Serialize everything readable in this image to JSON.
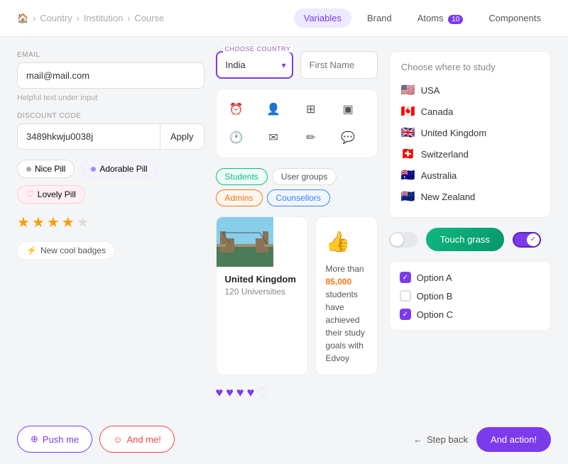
{
  "topbar": {
    "breadcrumb": [
      "Home",
      "Country",
      "Institution",
      "Course"
    ],
    "nav_tabs": [
      {
        "label": "Variables",
        "active": true,
        "badge": null
      },
      {
        "label": "Brand",
        "active": false,
        "badge": null
      },
      {
        "label": "Atoms",
        "active": false,
        "badge": "10"
      },
      {
        "label": "Components",
        "active": false,
        "badge": null
      }
    ]
  },
  "col1": {
    "email_label": "EMAIL",
    "email_value": "mail@mail.com",
    "helper_text": "Helpful text under input",
    "discount_label": "DISCOUNT CODE",
    "discount_value": "3489hkwju0038j",
    "apply_label": "Apply",
    "pills": [
      {
        "label": "Nice Pill",
        "dot_color": "#aaa",
        "bg": "#fff"
      },
      {
        "label": "Adorable Pill",
        "dot_color": "#a78bfa",
        "bg": "#f5f3ff"
      },
      {
        "label": "Lovely Pill",
        "icon": "♡",
        "bg": "#fff0f6"
      }
    ],
    "stars": [
      true,
      true,
      true,
      true,
      false
    ],
    "badge_btn_label": "New cool badges",
    "push_btn_label": "Push me",
    "and_me_btn_label": "And me!"
  },
  "col2": {
    "choose_country_label": "CHOOSE COUNTRY",
    "country_value": "India",
    "first_name_placeholder": "First Name",
    "icons": [
      "⏰",
      "👤",
      "⊞",
      "▣",
      "🕐",
      "✉",
      "✏",
      "💬"
    ],
    "tags": [
      "Students",
      "User groups",
      "Admins",
      "Counsellors"
    ],
    "tag_types": [
      "green",
      "default",
      "orange",
      "blue"
    ],
    "country_card": {
      "name": "United Kingdom",
      "universities": "120 Universities"
    },
    "info_card": {
      "text_before": "More than ",
      "highlight": "85,000",
      "text_after": " students have achieved their study goals with Edvoy"
    },
    "hearts": [
      true,
      true,
      true,
      true,
      false
    ]
  },
  "col3": {
    "study_title": "Choose where to study",
    "countries": [
      {
        "flag": "🇺🇸",
        "name": "USA"
      },
      {
        "flag": "🇨🇦",
        "name": "Canada"
      },
      {
        "flag": "🇬🇧",
        "name": "United Kingdom"
      },
      {
        "flag": "🇨🇭",
        "name": "Switzerland"
      },
      {
        "flag": "🇦🇺",
        "name": "Australia"
      },
      {
        "flag": "🇳🇿",
        "name": "New Zealand"
      }
    ],
    "touch_grass_label": "Touch grass",
    "checkboxes": [
      {
        "label": "Option A",
        "checked": true
      },
      {
        "label": "Option B",
        "checked": false
      },
      {
        "label": "Option C",
        "checked": true
      }
    ],
    "step_back_label": "Step back",
    "and_action_label": "And action!"
  }
}
